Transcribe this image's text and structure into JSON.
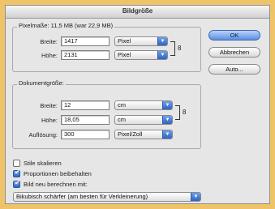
{
  "window": {
    "title": "Bildgröße"
  },
  "pixel_section": {
    "legend": "Pixelmaße: 11,5 MB (war 22,9 MB)",
    "width": {
      "label": "Breite:",
      "value": "1417",
      "unit": "Pixel"
    },
    "height": {
      "label": "Höhe:",
      "value": "2131",
      "unit": "Pixel"
    }
  },
  "doc_section": {
    "legend": "Dokumentgröße:",
    "width": {
      "label": "Breite:",
      "value": "12",
      "unit": "cm"
    },
    "height": {
      "label": "Höhe:",
      "value": "18,05",
      "unit": "cm"
    },
    "resolution": {
      "label": "Auflösung:",
      "value": "300",
      "unit": "Pixel/Zoll"
    }
  },
  "buttons": {
    "ok": "OK",
    "cancel": "Abbrechen",
    "auto": "Auto..."
  },
  "options": [
    {
      "label": "Stile skalieren",
      "checked": false
    },
    {
      "label": "Proportionen beibehalten",
      "checked": true
    },
    {
      "label": "Bild neu berechnen mit:",
      "checked": true
    }
  ],
  "resample": {
    "value": "Bikubisch schärfer (am besten für Verkleinerung)"
  },
  "colors": {
    "frame": "#efc469",
    "dialog": "#e6e6e6",
    "accent": "#2e63c4"
  }
}
